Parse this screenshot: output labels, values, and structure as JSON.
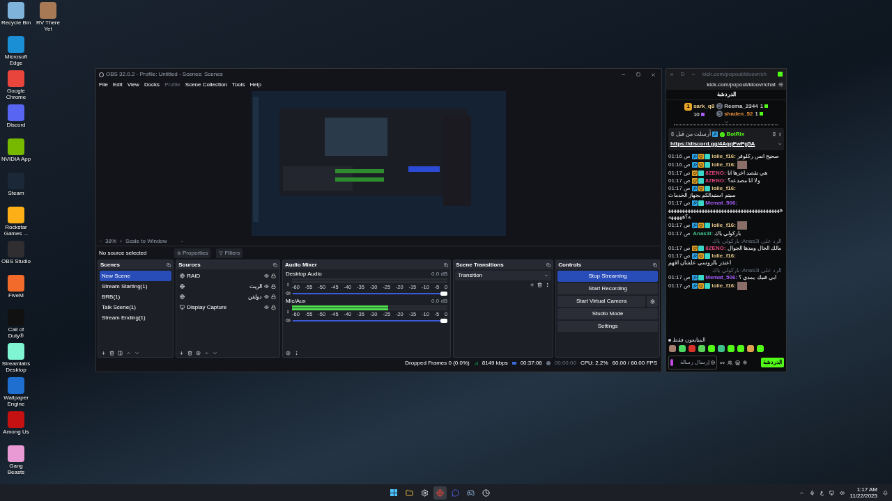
{
  "desktop": {
    "columns": [
      [
        {
          "label": "Recycle Bin",
          "color": "#7fb3d9"
        },
        {
          "label": "Microsoft Edge",
          "color": "#1b8fd6"
        },
        {
          "label": "Google Chrome",
          "color": "#e8453c"
        },
        {
          "label": "Discord",
          "color": "#5865f2"
        },
        {
          "label": "NVIDIA App",
          "color": "#76b900"
        },
        {
          "label": "Steam",
          "color": "#1b2838"
        },
        {
          "label": "Rockstar Games ...",
          "color": "#fcaf17"
        },
        {
          "label": "OBS Studio",
          "color": "#302e31"
        },
        {
          "label": "FiveM",
          "color": "#f26b2a"
        },
        {
          "label": "Call of Duty®",
          "color": "#111111"
        },
        {
          "label": "Streamlabs Desktop",
          "color": "#80f5d2"
        },
        {
          "label": "Wallpaper Engine",
          "color": "#1f6fd1"
        },
        {
          "label": "Among Us",
          "color": "#c51111"
        },
        {
          "label": "Gang Beasts",
          "color": "#e99ad4"
        }
      ],
      [
        {
          "label": "RV There Yet",
          "color": "#a77a55"
        }
      ]
    ]
  },
  "obs": {
    "title": "OBS 32.0.2 - Profile: Untitled - Scenes: Scenes",
    "menu": [
      {
        "label": "File",
        "disabled": false
      },
      {
        "label": "Edit",
        "disabled": false
      },
      {
        "label": "View",
        "disabled": false
      },
      {
        "label": "Docks",
        "disabled": false
      },
      {
        "label": "Profile",
        "disabled": true
      },
      {
        "label": "Scene Collection",
        "disabled": false
      },
      {
        "label": "Tools",
        "disabled": false
      },
      {
        "label": "Help",
        "disabled": false
      }
    ],
    "zoom": "38%",
    "scale_mode": "Scale to Window",
    "source_bar": {
      "label": "No source selected",
      "buttons": [
        "Properties",
        "Filters"
      ]
    },
    "scenes": {
      "title": "Scenes",
      "items": [
        {
          "label": "New Scene",
          "selected": true
        },
        {
          "label": "Stream Starting(1)",
          "selected": false
        },
        {
          "label": "BRB(1)",
          "selected": false
        },
        {
          "label": "Talk Scene(1)",
          "selected": false
        },
        {
          "label": "Stream Ending(1)",
          "selected": false
        }
      ]
    },
    "sources": {
      "title": "Sources",
      "items": [
        {
          "label": "RAID",
          "kind": "browser",
          "visible": true,
          "locked": true
        },
        {
          "label": "الريت",
          "kind": "browser",
          "visible": true,
          "locked": true
        },
        {
          "label": "دولفن",
          "kind": "browser",
          "visible": true,
          "locked": true
        },
        {
          "label": "Display Capture",
          "kind": "display",
          "visible": true,
          "locked": true
        }
      ]
    },
    "audio": {
      "title": "Audio Mixer",
      "channels": [
        {
          "name": "Desktop Audio",
          "reading": "0.0 dB",
          "ticks": [
            "-60",
            "-55",
            "-50",
            "-45",
            "-40",
            "-35",
            "-30",
            "-25",
            "-20",
            "-15",
            "-10",
            "-5",
            "0"
          ],
          "meter": {
            "level": 0
          },
          "volume": {
            "level": 1
          }
        },
        {
          "name": "Mic/Aux",
          "reading": "0.0 dB",
          "ticks": [
            "-60",
            "-55",
            "-50",
            "-45",
            "-40",
            "-35",
            "-30",
            "-25",
            "-20",
            "-15",
            "-10",
            "-5",
            "0"
          ],
          "meter": {
            "level": 0.62
          },
          "volume": {
            "level": 1
          }
        }
      ]
    },
    "transitions": {
      "title": "Scene Transitions",
      "value": "Transition"
    },
    "controls": {
      "title": "Controls",
      "buttons": [
        {
          "label": "Stop Streaming",
          "active": true,
          "kind": "plain"
        },
        {
          "label": "Start Recording",
          "active": false,
          "kind": "plain"
        },
        {
          "label": "Start Virtual Camera",
          "active": false,
          "kind": "with_settings"
        },
        {
          "label": "Studio Mode",
          "active": false,
          "kind": "plain"
        },
        {
          "label": "Settings",
          "active": false,
          "kind": "plain"
        }
      ]
    },
    "status": {
      "dropped": "Dropped Frames 0 (0.0%)",
      "bitrate": "8149 kbps",
      "stream_time": "00:37:06",
      "record_time": "00:00:00",
      "cpu": "CPU: 2.2%",
      "fps": "60.00 / 60.00 FPS"
    }
  },
  "chat": {
    "title": "kick.com/popout/kloovr/ch",
    "url": "kick.com/popout/kloovr/chat",
    "header": "الدردشة",
    "leaderboard": [
      {
        "rank": "1",
        "name": "sark_q8",
        "count": "10",
        "color": "#e8c98a"
      },
      {
        "rank": "2",
        "name": "Reema_2344",
        "count": "1",
        "color": "#c9c9c9"
      },
      {
        "rank": "3",
        "name": "shaden_52",
        "count": "1",
        "color": "#e8913a"
      }
    ],
    "pinned": {
      "label": "أرسلت من قبل",
      "sender": "BotRix",
      "link": "https://discord.gg/4AqqFwPg5A"
    },
    "messages": [
      {
        "kind": "text",
        "time": "01:16 ص",
        "badges": [
          {
            "kind": "mod"
          },
          {
            "kind": "crown"
          },
          {
            "kind": "sub"
          }
        ],
        "name": "lolie_f16:",
        "color": "#e8c98a",
        "text": "صحيح انس ركلوفر"
      },
      {
        "kind": "emote",
        "time": "01:16 ص",
        "badges": [
          {
            "kind": "mod"
          },
          {
            "kind": "crown"
          },
          {
            "kind": "sub"
          }
        ],
        "name": "lolie_f16:",
        "color": "#e8c98a"
      },
      {
        "kind": "text",
        "time": "01:17 ص",
        "badges": [
          {
            "kind": "crown"
          },
          {
            "kind": "sub"
          }
        ],
        "name": "8ZENO:",
        "color": "#e0457b",
        "text": "هي تقصد اخرها انا"
      },
      {
        "kind": "text",
        "time": "01:17 ص",
        "badges": [
          {
            "kind": "crown"
          },
          {
            "kind": "sub"
          }
        ],
        "name": "8ZENO:",
        "color": "#e0457b",
        "text": "ولا انا مصدعه؟"
      },
      {
        "kind": "text",
        "time": "01:17 ص",
        "badges": [
          {
            "kind": "mod"
          },
          {
            "kind": "crown"
          },
          {
            "kind": "sub"
          }
        ],
        "name": "lolie_f16:",
        "color": "#e8c98a",
        "text": "سيتم استبدالكم بجهاز الخدمات"
      },
      {
        "kind": "text",
        "time": "01:17 ص",
        "badges": [
          {
            "kind": "mod"
          },
          {
            "kind": "sub"
          }
        ],
        "name": "Memat_506:",
        "color": "#a45cf5",
        "text": "هههههههههههههههههههههههههههههههههههههههههه؟هههههه"
      },
      {
        "kind": "emote",
        "time": "01:17 ص",
        "badges": [
          {
            "kind": "mod"
          },
          {
            "kind": "crown"
          },
          {
            "kind": "sub"
          }
        ],
        "name": "lolie_f16:",
        "color": "#e8c98a"
      },
      {
        "kind": "text",
        "time": "01:17 ص",
        "name": "Anas3l:",
        "color": "#3fc28a",
        "text": "باركولي ياك"
      },
      {
        "kind": "text",
        "time": "01:17 ص",
        "badges": [
          {
            "kind": "crown"
          },
          {
            "kind": "sub"
          }
        ],
        "name": "8ZENO:",
        "color": "#e0457b",
        "text": "مالك الحال ومدها الجوال",
        "reply": "الرد على Anas3l: باركولي ياك"
      },
      {
        "kind": "text",
        "time": "01:17 ص",
        "badges": [
          {
            "kind": "mod"
          },
          {
            "kind": "crown"
          },
          {
            "kind": "sub"
          }
        ],
        "name": "lolie_f16:",
        "color": "#e8c98a",
        "text": "اعتذر بالروسي علشان افهم"
      },
      {
        "kind": "text",
        "time": "01:17 ص",
        "badges": [
          {
            "kind": "mod"
          },
          {
            "kind": "sub"
          }
        ],
        "name": "Memat_506:",
        "color": "#a45cf5",
        "text": "ابي فنيك يمدي ؟",
        "reply": "الرد على Anas3l: باركولي ياك"
      },
      {
        "kind": "emote",
        "time": "01:17 ص",
        "badges": [
          {
            "kind": "mod"
          },
          {
            "kind": "crown"
          },
          {
            "kind": "sub"
          }
        ],
        "name": "lolie_f16:",
        "color": "#e8c98a"
      }
    ],
    "followers_only": "المتابعون فقط",
    "emotes": [
      {
        "color": "#a88070"
      },
      {
        "color": "#4cd964"
      },
      {
        "color": "#d9342b"
      },
      {
        "color": "#5bd35b"
      },
      {
        "color": "#53fc18"
      },
      {
        "color": "#3fc28a"
      },
      {
        "color": "#53fc18"
      },
      {
        "color": "#53fc18"
      },
      {
        "color": "#e0a050"
      },
      {
        "color": "#53fc18"
      }
    ],
    "input": {
      "placeholder": "إرسال رسالة"
    },
    "send": "الدردشة"
  },
  "taskbar": {
    "apps": [
      {
        "kind": "start",
        "active": false
      },
      {
        "kind": "folder",
        "active": false
      },
      {
        "kind": "gear",
        "active": false
      },
      {
        "kind": "browser",
        "active": true
      },
      {
        "kind": "chat",
        "active": false
      },
      {
        "kind": "steam",
        "active": false
      },
      {
        "kind": "clock",
        "active": false
      }
    ],
    "language": "ع",
    "time": "1:17 AM",
    "date": "11/22/2025"
  }
}
